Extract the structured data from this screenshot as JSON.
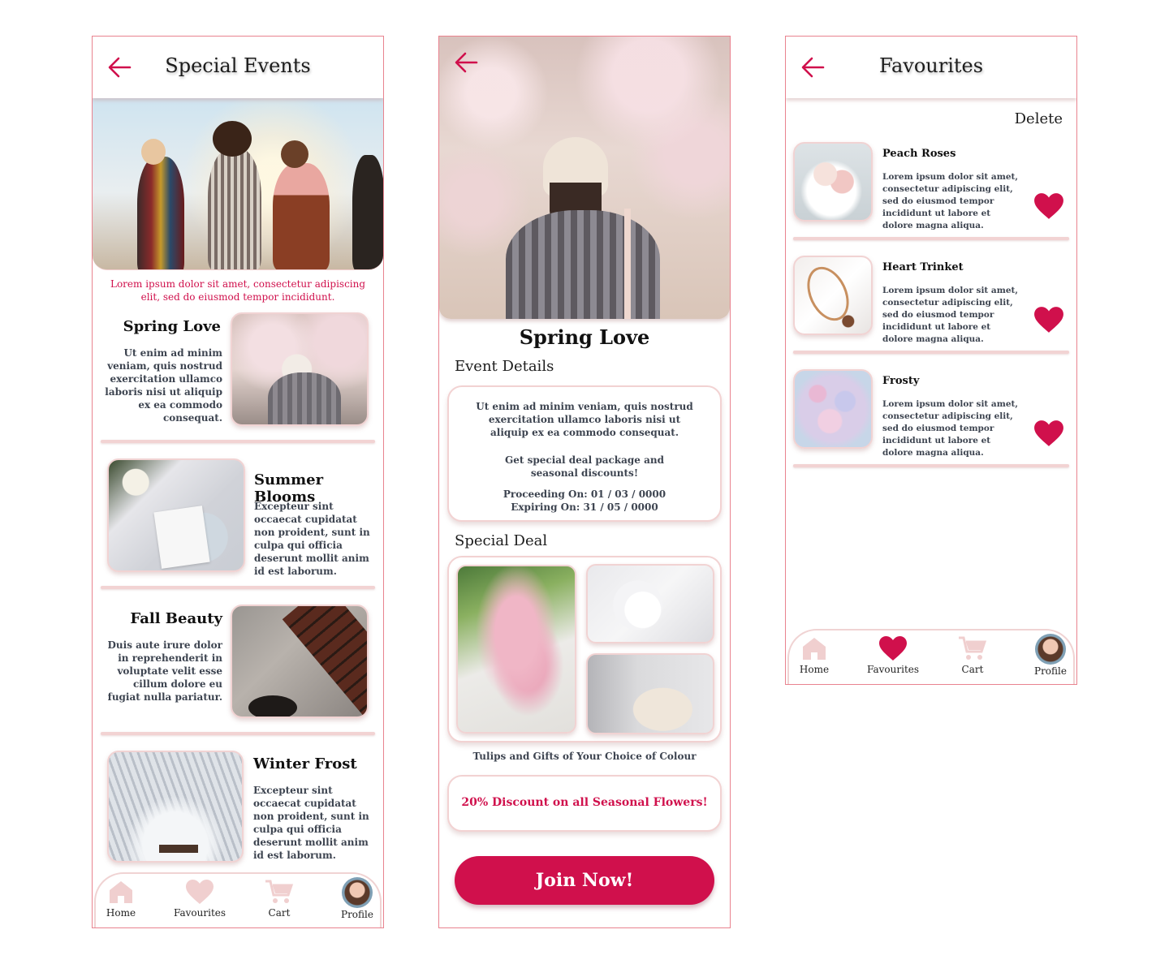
{
  "colors": {
    "accent": "#d0104c",
    "soft_pink": "#f2d3d3",
    "border": "#e9838f",
    "text_muted": "#3d4450"
  },
  "screen1": {
    "title": "Special Events",
    "tagline": "Lorem ipsum dolor sit amet, consectetur adipiscing elit, sed do eiusmod tempor incididunt.",
    "events": [
      {
        "title": "Spring Love",
        "desc": "Ut enim ad minim veniam, quis nostrud exercitation ullamco laboris nisi ut aliquip ex ea commodo consequat."
      },
      {
        "title": "Summer Blooms",
        "desc": "Excepteur sint occaecat cupidatat non proident, sunt in culpa qui officia deserunt mollit anim id est laborum."
      },
      {
        "title": "Fall Beauty",
        "desc": "Duis aute irure dolor in reprehenderit in voluptate velit esse cillum dolore eu fugiat nulla pariatur."
      },
      {
        "title": "Winter Frost",
        "desc": "Excepteur sint occaecat cupidatat non proident, sunt in culpa qui officia deserunt mollit anim id est laborum."
      }
    ]
  },
  "screen2": {
    "title": "Spring Love",
    "event_details_heading": "Event Details",
    "details_text": "Ut enim ad minim veniam, quis nostrud exercitation ullamco laboris nisi ut aliquip ex ea commodo consequat.",
    "deal_text": "Get special deal package and seasonal discounts!",
    "proceeding": "Proceeding On: 01 / 03 / 0000",
    "expiring": "Expiring On: 31 / 05 / 0000",
    "special_deal_heading": "Special Deal",
    "deal_caption": "Tulips and Gifts of Your Choice of Colour",
    "discount": "20% Discount on all Seasonal Flowers!",
    "join_label": "Join Now!"
  },
  "screen3": {
    "title": "Favourites",
    "delete_label": "Delete",
    "items": [
      {
        "title": "Peach Roses",
        "desc": "Lorem ipsum dolor sit amet, consectetur adipiscing elit, sed do eiusmod tempor incididunt ut labore et dolore magna aliqua."
      },
      {
        "title": "Heart Trinket",
        "desc": "Lorem ipsum dolor sit amet, consectetur adipiscing elit, sed do eiusmod tempor incididunt ut labore et dolore magna aliqua."
      },
      {
        "title": "Frosty",
        "desc": "Lorem ipsum dolor sit amet, consectetur adipiscing elit, sed do eiusmod tempor incididunt ut labore et dolore magna aliqua."
      }
    ]
  },
  "nav": {
    "home": "Home",
    "favourites": "Favourites",
    "cart": "Cart",
    "profile": "Profile"
  },
  "icons": [
    "back-arrow-icon",
    "home-icon",
    "heart-icon",
    "cart-icon",
    "avatar"
  ]
}
